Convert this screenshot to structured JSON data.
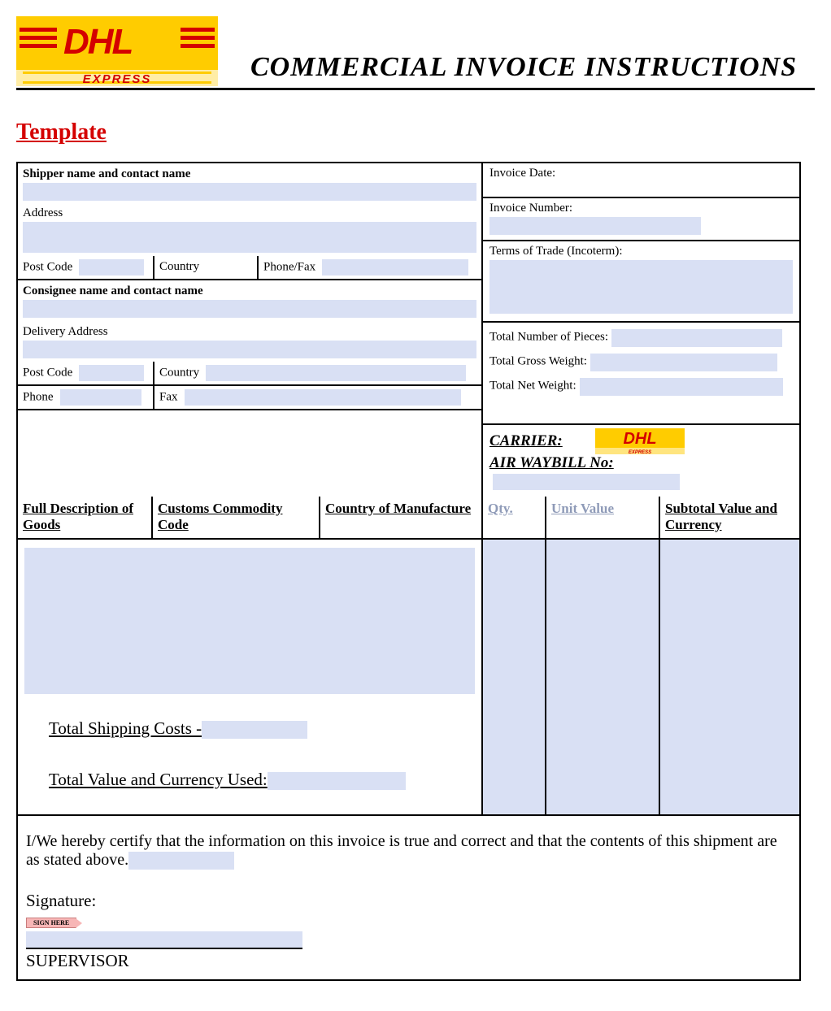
{
  "logo": {
    "brand": "DHL",
    "sub": "EXPRESS"
  },
  "title": "COMMERCIAL INVOICE INSTRUCTIONS",
  "template_link": "Template",
  "shipper": {
    "name_label": "Shipper  name and contact name",
    "address_label": "Address",
    "postcode_label": "Post Code",
    "country_label": "Country",
    "phonefax_label": "Phone/Fax"
  },
  "consignee": {
    "name_label": "Consignee  name and contact name",
    "delivery_label": "Delivery Address",
    "postcode_label": "Post Code",
    "country_label": "Country",
    "phone_label": "Phone",
    "fax_label": "Fax"
  },
  "invoice": {
    "date_label": "Invoice Date:",
    "number_label": "Invoice Number:",
    "terms_label": "Terms of Trade (Incoterm):",
    "pieces_label": "Total Number of Pieces:",
    "gross_label": "Total Gross Weight:",
    "net_label": "Total Net Weight:"
  },
  "carrier": {
    "label": "CARRIER:",
    "awb_label": "AIR WAYBILL No:"
  },
  "items": {
    "col_desc": "Full Description of Goods",
    "col_commodity": "Customs Commodity Code",
    "col_country": "Country of Manufacture",
    "col_qty": "Qty.",
    "col_unit": "Unit Value",
    "col_subtotal": "Subtotal Value and Currency",
    "total_shipping_label": "Total Shipping Costs -",
    "total_value_label": "Total Value and Currency Used:"
  },
  "cert": {
    "text": "I/We hereby certify that the information on this invoice is true and correct and that the contents of this shipment are as stated above.",
    "signature_label": "Signature:",
    "tag": "SIGN HERE",
    "supervisor": "SUPERVISOR"
  }
}
